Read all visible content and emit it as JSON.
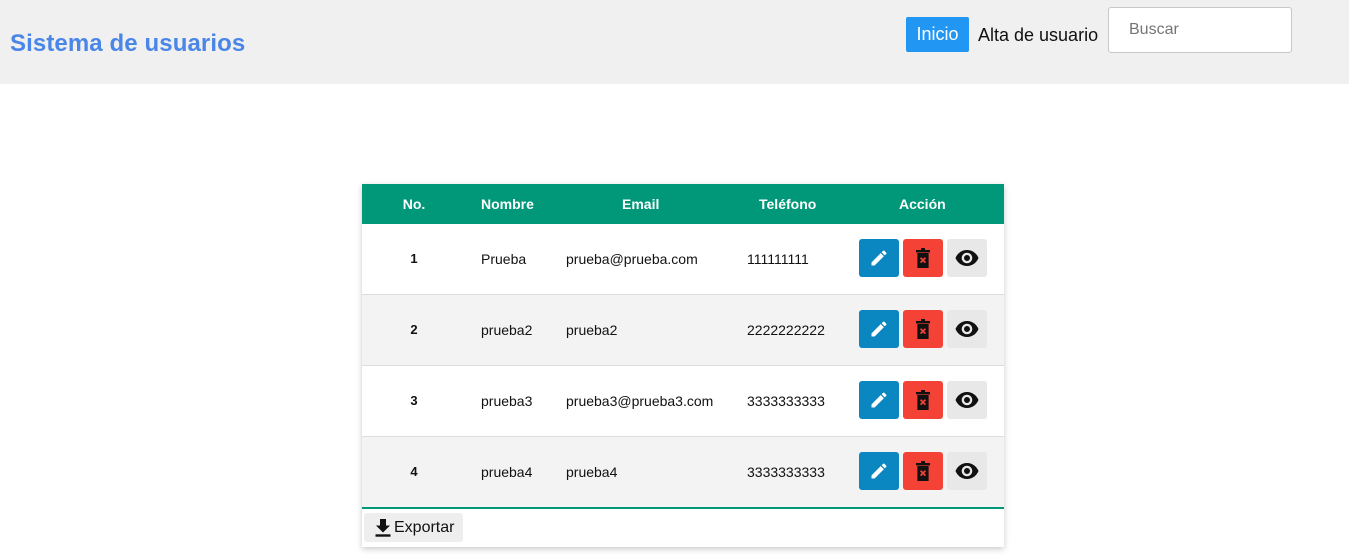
{
  "header": {
    "brand": "Sistema de usuarios",
    "nav_home": "Inicio",
    "nav_new_user": "Alta de usuario",
    "search_placeholder": "Buscar",
    "search_value": ""
  },
  "table": {
    "columns": [
      "No.",
      "Nombre",
      "Email",
      "Teléfono",
      "Acción"
    ],
    "rows": [
      {
        "no": "1",
        "name": "Prueba",
        "email": "prueba@prueba.com",
        "phone": "111111111"
      },
      {
        "no": "2",
        "name": "prueba2",
        "email": "prueba2",
        "phone": "2222222222"
      },
      {
        "no": "3",
        "name": "prueba3",
        "email": "prueba3@prueba3.com",
        "phone": "3333333333"
      },
      {
        "no": "4",
        "name": "prueba4",
        "email": "prueba4",
        "phone": "3333333333"
      }
    ],
    "actions": {
      "edit_icon": "pencil-icon",
      "delete_icon": "trash-icon",
      "view_icon": "eye-icon"
    }
  },
  "footer": {
    "export_label": "Exportar",
    "export_icon": "download-icon"
  },
  "colors": {
    "brand": "#4a86e8",
    "primary_button": "#2196f3",
    "table_header": "#009879",
    "edit_button": "#0a86c0",
    "delete_button": "#f44336",
    "view_button": "#e8e8e8",
    "row_alt": "#f3f3f3",
    "topbar": "#f0f0f0"
  }
}
